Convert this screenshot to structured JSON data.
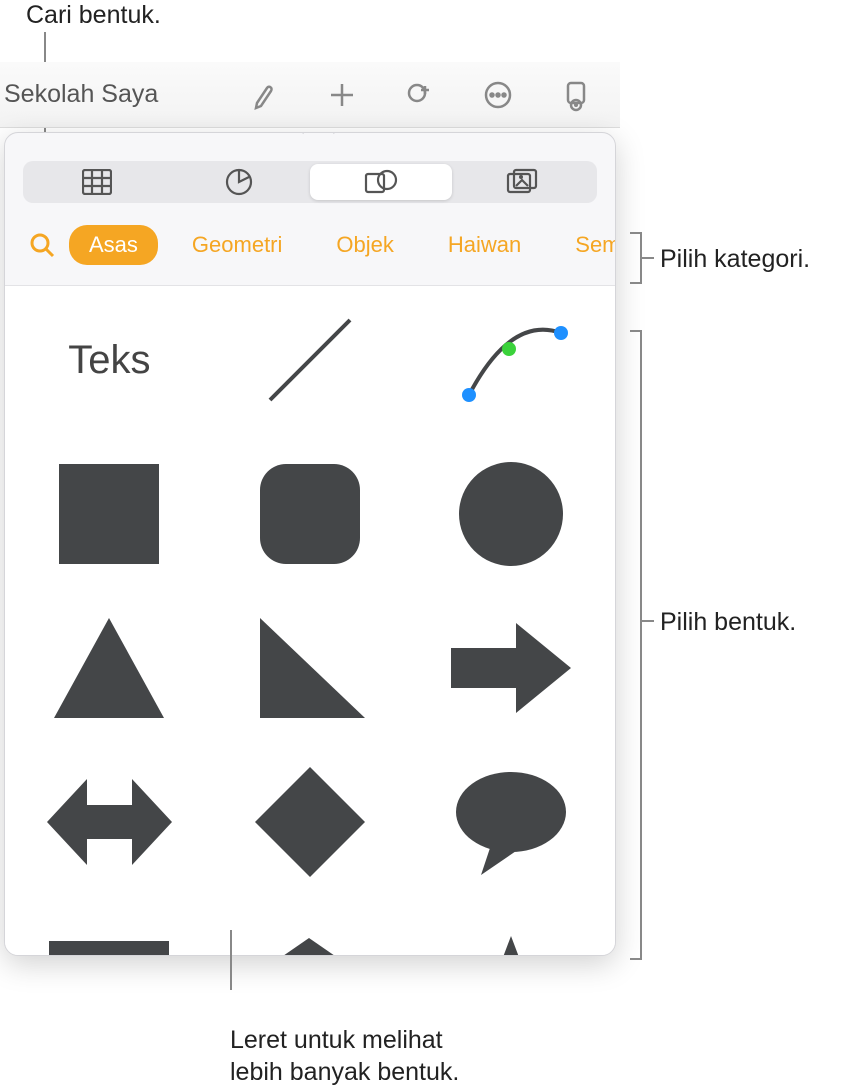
{
  "callouts": {
    "search": "Cari bentuk.",
    "category": "Pilih kategori.",
    "shape": "Pilih bentuk.",
    "swipe": "Leret untuk melihat\nlebih banyak bentuk."
  },
  "toolbar": {
    "document_title": "Sekolah Saya"
  },
  "popover": {
    "segments": [
      "table",
      "chart",
      "shape",
      "media"
    ],
    "active_segment": "shape",
    "categories": [
      {
        "id": "asas",
        "label": "Asas",
        "active": true
      },
      {
        "id": "geometri",
        "label": "Geometri",
        "active": false
      },
      {
        "id": "objek",
        "label": "Objek",
        "active": false
      },
      {
        "id": "haiwan",
        "label": "Haiwan",
        "active": false
      },
      {
        "id": "semua",
        "label": "Sem",
        "active": false
      }
    ],
    "text_shape_label": "Teks",
    "shapes": [
      {
        "id": "text",
        "kind": "text"
      },
      {
        "id": "line",
        "kind": "svg"
      },
      {
        "id": "curve",
        "kind": "svg"
      },
      {
        "id": "square",
        "kind": "svg"
      },
      {
        "id": "rounded-square",
        "kind": "svg"
      },
      {
        "id": "circle",
        "kind": "svg"
      },
      {
        "id": "triangle",
        "kind": "svg"
      },
      {
        "id": "right-triangle",
        "kind": "svg"
      },
      {
        "id": "arrow-right",
        "kind": "svg"
      },
      {
        "id": "arrow-double",
        "kind": "svg"
      },
      {
        "id": "diamond",
        "kind": "svg"
      },
      {
        "id": "speech-bubble",
        "kind": "svg"
      },
      {
        "id": "callout-rect",
        "kind": "svg"
      },
      {
        "id": "pentagon",
        "kind": "svg"
      },
      {
        "id": "star",
        "kind": "svg"
      }
    ]
  }
}
